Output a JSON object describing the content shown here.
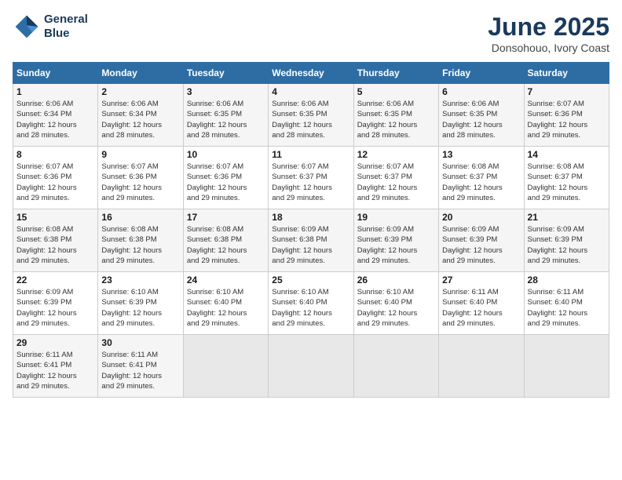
{
  "header": {
    "logo_line1": "General",
    "logo_line2": "Blue",
    "title": "June 2025",
    "subtitle": "Donsohouo, Ivory Coast"
  },
  "days_of_week": [
    "Sunday",
    "Monday",
    "Tuesday",
    "Wednesday",
    "Thursday",
    "Friday",
    "Saturday"
  ],
  "weeks": [
    [
      {
        "day": "1",
        "sunrise": "6:06 AM",
        "sunset": "6:34 PM",
        "daylight": "12 hours and 28 minutes."
      },
      {
        "day": "2",
        "sunrise": "6:06 AM",
        "sunset": "6:34 PM",
        "daylight": "12 hours and 28 minutes."
      },
      {
        "day": "3",
        "sunrise": "6:06 AM",
        "sunset": "6:35 PM",
        "daylight": "12 hours and 28 minutes."
      },
      {
        "day": "4",
        "sunrise": "6:06 AM",
        "sunset": "6:35 PM",
        "daylight": "12 hours and 28 minutes."
      },
      {
        "day": "5",
        "sunrise": "6:06 AM",
        "sunset": "6:35 PM",
        "daylight": "12 hours and 28 minutes."
      },
      {
        "day": "6",
        "sunrise": "6:06 AM",
        "sunset": "6:35 PM",
        "daylight": "12 hours and 28 minutes."
      },
      {
        "day": "7",
        "sunrise": "6:07 AM",
        "sunset": "6:36 PM",
        "daylight": "12 hours and 29 minutes."
      }
    ],
    [
      {
        "day": "8",
        "sunrise": "6:07 AM",
        "sunset": "6:36 PM",
        "daylight": "12 hours and 29 minutes."
      },
      {
        "day": "9",
        "sunrise": "6:07 AM",
        "sunset": "6:36 PM",
        "daylight": "12 hours and 29 minutes."
      },
      {
        "day": "10",
        "sunrise": "6:07 AM",
        "sunset": "6:36 PM",
        "daylight": "12 hours and 29 minutes."
      },
      {
        "day": "11",
        "sunrise": "6:07 AM",
        "sunset": "6:37 PM",
        "daylight": "12 hours and 29 minutes."
      },
      {
        "day": "12",
        "sunrise": "6:07 AM",
        "sunset": "6:37 PM",
        "daylight": "12 hours and 29 minutes."
      },
      {
        "day": "13",
        "sunrise": "6:08 AM",
        "sunset": "6:37 PM",
        "daylight": "12 hours and 29 minutes."
      },
      {
        "day": "14",
        "sunrise": "6:08 AM",
        "sunset": "6:37 PM",
        "daylight": "12 hours and 29 minutes."
      }
    ],
    [
      {
        "day": "15",
        "sunrise": "6:08 AM",
        "sunset": "6:38 PM",
        "daylight": "12 hours and 29 minutes."
      },
      {
        "day": "16",
        "sunrise": "6:08 AM",
        "sunset": "6:38 PM",
        "daylight": "12 hours and 29 minutes."
      },
      {
        "day": "17",
        "sunrise": "6:08 AM",
        "sunset": "6:38 PM",
        "daylight": "12 hours and 29 minutes."
      },
      {
        "day": "18",
        "sunrise": "6:09 AM",
        "sunset": "6:38 PM",
        "daylight": "12 hours and 29 minutes."
      },
      {
        "day": "19",
        "sunrise": "6:09 AM",
        "sunset": "6:39 PM",
        "daylight": "12 hours and 29 minutes."
      },
      {
        "day": "20",
        "sunrise": "6:09 AM",
        "sunset": "6:39 PM",
        "daylight": "12 hours and 29 minutes."
      },
      {
        "day": "21",
        "sunrise": "6:09 AM",
        "sunset": "6:39 PM",
        "daylight": "12 hours and 29 minutes."
      }
    ],
    [
      {
        "day": "22",
        "sunrise": "6:09 AM",
        "sunset": "6:39 PM",
        "daylight": "12 hours and 29 minutes."
      },
      {
        "day": "23",
        "sunrise": "6:10 AM",
        "sunset": "6:39 PM",
        "daylight": "12 hours and 29 minutes."
      },
      {
        "day": "24",
        "sunrise": "6:10 AM",
        "sunset": "6:40 PM",
        "daylight": "12 hours and 29 minutes."
      },
      {
        "day": "25",
        "sunrise": "6:10 AM",
        "sunset": "6:40 PM",
        "daylight": "12 hours and 29 minutes."
      },
      {
        "day": "26",
        "sunrise": "6:10 AM",
        "sunset": "6:40 PM",
        "daylight": "12 hours and 29 minutes."
      },
      {
        "day": "27",
        "sunrise": "6:11 AM",
        "sunset": "6:40 PM",
        "daylight": "12 hours and 29 minutes."
      },
      {
        "day": "28",
        "sunrise": "6:11 AM",
        "sunset": "6:40 PM",
        "daylight": "12 hours and 29 minutes."
      }
    ],
    [
      {
        "day": "29",
        "sunrise": "6:11 AM",
        "sunset": "6:41 PM",
        "daylight": "12 hours and 29 minutes."
      },
      {
        "day": "30",
        "sunrise": "6:11 AM",
        "sunset": "6:41 PM",
        "daylight": "12 hours and 29 minutes."
      },
      {
        "day": "",
        "sunrise": "",
        "sunset": "",
        "daylight": ""
      },
      {
        "day": "",
        "sunrise": "",
        "sunset": "",
        "daylight": ""
      },
      {
        "day": "",
        "sunrise": "",
        "sunset": "",
        "daylight": ""
      },
      {
        "day": "",
        "sunrise": "",
        "sunset": "",
        "daylight": ""
      },
      {
        "day": "",
        "sunrise": "",
        "sunset": "",
        "daylight": ""
      }
    ]
  ],
  "labels": {
    "sunrise_prefix": "Sunrise: ",
    "sunset_prefix": "Sunset: ",
    "daylight_prefix": "Daylight: "
  }
}
